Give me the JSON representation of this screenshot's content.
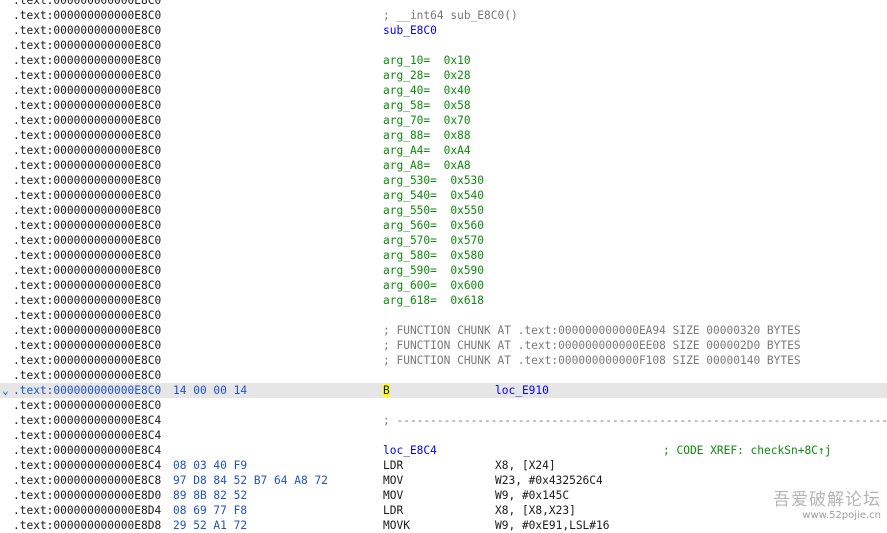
{
  "colors": {
    "address": "#1a1a1a",
    "current_address": "#1f52c8",
    "bytes": "#1f52c8",
    "label": "#0000ff",
    "stack_var": "#0f8a0f",
    "comment": "#7a7a7a",
    "current_line_bg": "#e6e6e6",
    "highlight": "#ffff00"
  },
  "icons": {
    "current_line_marker": "caret-icon"
  },
  "rows": [
    {
      "addr": ".text:000000000000E8C0",
      "bytes": "",
      "kind": "blank"
    },
    {
      "addr": ".text:000000000000E8C0",
      "kind": "comment",
      "text": "; __int64 sub_E8C0()"
    },
    {
      "addr": ".text:000000000000E8C0",
      "kind": "label",
      "text": "sub_E8C0"
    },
    {
      "addr": ".text:000000000000E8C0",
      "kind": "blank"
    },
    {
      "addr": ".text:000000000000E8C0",
      "kind": "arg",
      "text": "arg_10=  0x10"
    },
    {
      "addr": ".text:000000000000E8C0",
      "kind": "arg",
      "text": "arg_28=  0x28"
    },
    {
      "addr": ".text:000000000000E8C0",
      "kind": "arg",
      "text": "arg_40=  0x40"
    },
    {
      "addr": ".text:000000000000E8C0",
      "kind": "arg",
      "text": "arg_58=  0x58"
    },
    {
      "addr": ".text:000000000000E8C0",
      "kind": "arg",
      "text": "arg_70=  0x70"
    },
    {
      "addr": ".text:000000000000E8C0",
      "kind": "arg",
      "text": "arg_88=  0x88"
    },
    {
      "addr": ".text:000000000000E8C0",
      "kind": "arg",
      "text": "arg_A4=  0xA4"
    },
    {
      "addr": ".text:000000000000E8C0",
      "kind": "arg",
      "text": "arg_A8=  0xA8"
    },
    {
      "addr": ".text:000000000000E8C0",
      "kind": "arg",
      "text": "arg_530=  0x530"
    },
    {
      "addr": ".text:000000000000E8C0",
      "kind": "arg",
      "text": "arg_540=  0x540"
    },
    {
      "addr": ".text:000000000000E8C0",
      "kind": "arg",
      "text": "arg_550=  0x550"
    },
    {
      "addr": ".text:000000000000E8C0",
      "kind": "arg",
      "text": "arg_560=  0x560"
    },
    {
      "addr": ".text:000000000000E8C0",
      "kind": "arg",
      "text": "arg_570=  0x570"
    },
    {
      "addr": ".text:000000000000E8C0",
      "kind": "arg",
      "text": "arg_580=  0x580"
    },
    {
      "addr": ".text:000000000000E8C0",
      "kind": "arg",
      "text": "arg_590=  0x590"
    },
    {
      "addr": ".text:000000000000E8C0",
      "kind": "arg",
      "text": "arg_600=  0x600"
    },
    {
      "addr": ".text:000000000000E8C0",
      "kind": "arg",
      "text": "arg_618=  0x618"
    },
    {
      "addr": ".text:000000000000E8C0",
      "kind": "blank"
    },
    {
      "addr": ".text:000000000000E8C0",
      "kind": "comment",
      "text": "; FUNCTION CHUNK AT .text:000000000000EA94 SIZE 00000320 BYTES"
    },
    {
      "addr": ".text:000000000000E8C0",
      "kind": "comment",
      "text": "; FUNCTION CHUNK AT .text:000000000000EE08 SIZE 000002D0 BYTES"
    },
    {
      "addr": ".text:000000000000E8C0",
      "kind": "comment",
      "text": "; FUNCTION CHUNK AT .text:000000000000F108 SIZE 00000140 BYTES"
    },
    {
      "addr": ".text:000000000000E8C0",
      "kind": "blank"
    },
    {
      "addr": ".text:000000000000E8C0",
      "kind": "insn",
      "current": true,
      "bytes": "14 00 00 14",
      "mnem": "B",
      "operand": "loc_E910"
    },
    {
      "addr": ".text:000000000000E8C0",
      "kind": "blank"
    },
    {
      "addr": ".text:000000000000E8C4",
      "kind": "comment",
      "text": "; ---------------------------------------------------------------------------"
    },
    {
      "addr": ".text:000000000000E8C4",
      "kind": "blank"
    },
    {
      "addr": ".text:000000000000E8C4",
      "kind": "label",
      "text": "loc_E8C4",
      "xref": "; CODE XREF: checkSn+8C↑j"
    },
    {
      "addr": ".text:000000000000E8C4",
      "kind": "insn",
      "bytes": "08 03 40 F9",
      "mnem": "LDR",
      "operand": "X8, [X24]"
    },
    {
      "addr": ".text:000000000000E8C8",
      "kind": "insn",
      "bytes": "97 D8 84 52 B7 64 A8 72",
      "mnem": "MOV",
      "operand": "W23, #0x432526C4"
    },
    {
      "addr": ".text:000000000000E8D0",
      "kind": "insn",
      "bytes": "89 8B 82 52",
      "mnem": "MOV",
      "operand": "W9, #0x145C"
    },
    {
      "addr": ".text:000000000000E8D4",
      "kind": "insn",
      "bytes": "08 69 77 F8",
      "mnem": "LDR",
      "operand": "X8, [X8,X23]"
    },
    {
      "addr": ".text:000000000000E8D8",
      "kind": "insn",
      "bytes": "29 52 A1 72",
      "mnem": "MOVK",
      "operand": "W9, #0xE91,LSL#16"
    }
  ],
  "watermark": {
    "main": "吾爱破解论坛",
    "sub": "www.52pojie.cn"
  }
}
